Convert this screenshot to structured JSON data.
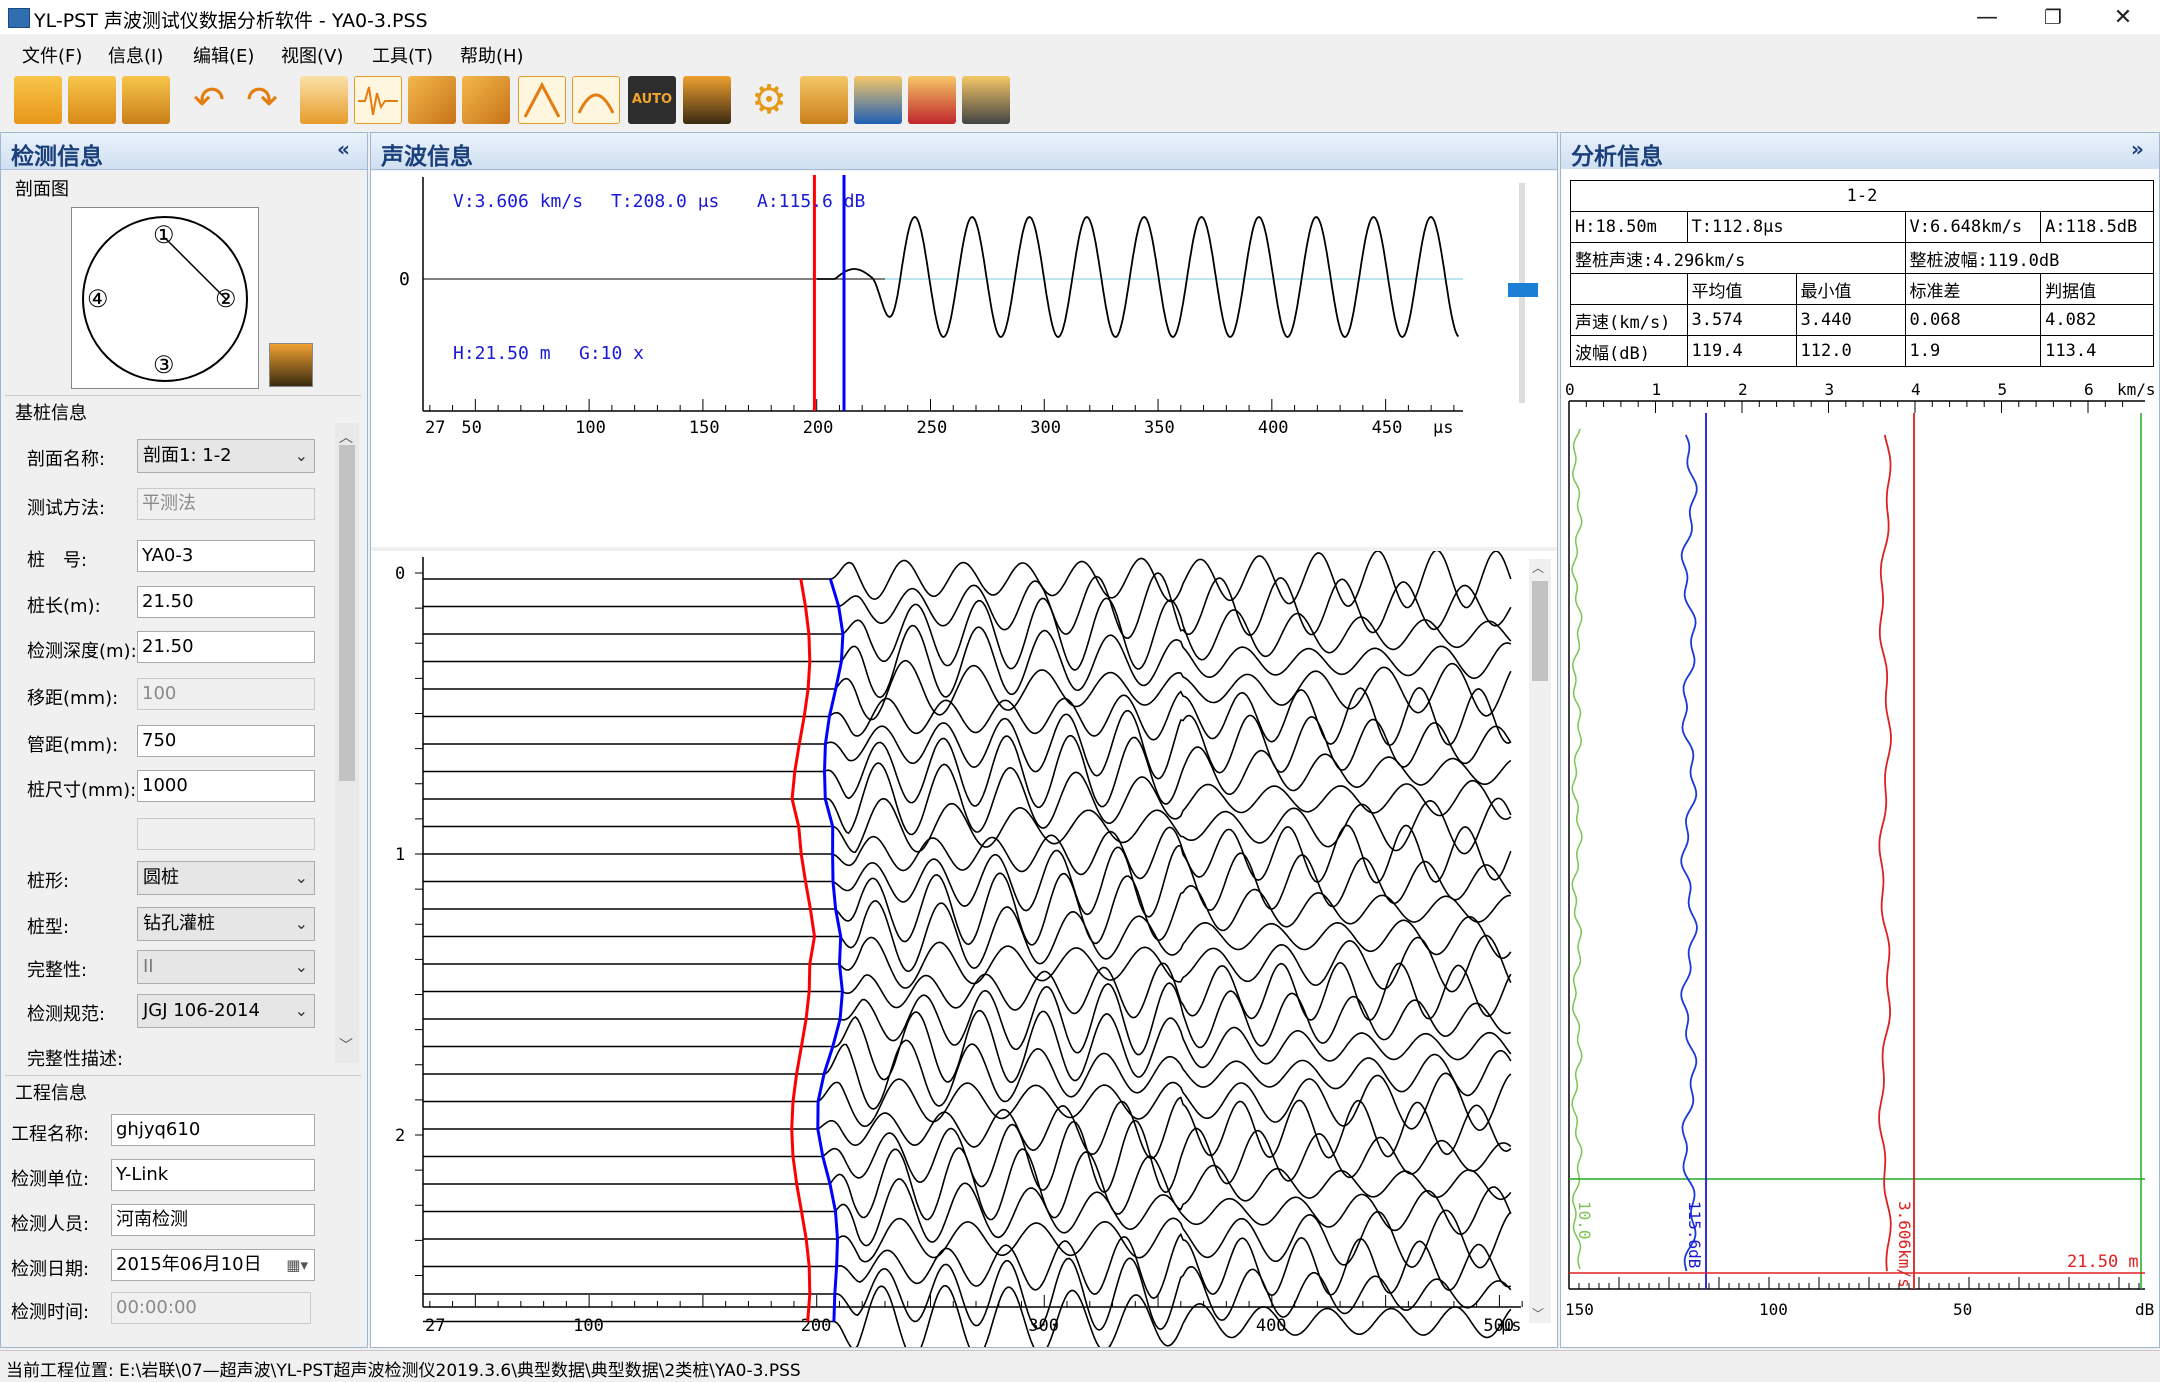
{
  "window": {
    "title": "YL-PST 声波测试仪数据分析软件 - YA0-3.PSS",
    "minimize": "—",
    "restore": "❐",
    "close": "✕"
  },
  "menu": [
    "文件(F)",
    "信息(I)",
    "编辑(E)",
    "视图(V)",
    "工具(T)",
    "帮助(H)"
  ],
  "toolbar": {
    "icons": [
      "open-folder-icon",
      "save-icon",
      "save-as-icon",
      "undo-icon",
      "redo-icon",
      "import-icon",
      "waveform-icon",
      "pile-edit-icon",
      "pile-edit-2-icon",
      "peak-up-icon",
      "peak-down-icon",
      "auto-icon",
      "people-icon",
      "settings-icon",
      "camera-settings-icon",
      "word-export-icon",
      "pdf-export-icon",
      "batch-settings-icon"
    ],
    "auto_label": "AUTO"
  },
  "left_panel": {
    "title": "检测信息",
    "collapse": "«",
    "section_profile": "剖面图",
    "diagram_labels": [
      "①",
      "②",
      "③",
      "④"
    ],
    "section_pile": "基桩信息",
    "fields": {
      "profile_name": {
        "label": "剖面名称:",
        "value": "剖面1: 1-2"
      },
      "test_method": {
        "label": "测试方法:",
        "value": "平测法"
      },
      "pile_no": {
        "label": "桩　号:",
        "value": "YA0-3"
      },
      "pile_length": {
        "label": "桩长(m):",
        "value": "21.50"
      },
      "test_depth": {
        "label": "检测深度(m):",
        "value": "21.50"
      },
      "offset": {
        "label": "移距(mm):",
        "value": "100"
      },
      "pipe_distance": {
        "label": "管距(mm):",
        "value": "750"
      },
      "pile_size": {
        "label": "桩尺寸(mm):",
        "value": "1000"
      },
      "blank": {
        "value": ""
      },
      "pile_shape": {
        "label": "桩形:",
        "value": "圆桩"
      },
      "pile_type": {
        "label": "桩型:",
        "value": "钻孔灌桩"
      },
      "integrity": {
        "label": "完整性:",
        "value": "II"
      },
      "standard": {
        "label": "检测规范:",
        "value": "JGJ 106-2014"
      },
      "integrity_desc": {
        "label": "完整性描述:"
      }
    },
    "section_project": "工程信息",
    "project": {
      "name": {
        "label": "工程名称:",
        "value": "ghjyq610"
      },
      "unit": {
        "label": "检测单位:",
        "value": "Y-Link"
      },
      "person": {
        "label": "检测人员:",
        "value": "河南检测"
      },
      "date": {
        "label": "检测日期:",
        "value": "2015年06月10日"
      },
      "time": {
        "label": "检测时间:",
        "value": "00:00:00"
      }
    }
  },
  "middle_panel": {
    "title": "声波信息",
    "wave_info": {
      "v": "V:3.606 km/s",
      "t": "T:208.0 μs",
      "a": "A:115.6 dB",
      "h": "H:21.50 m",
      "g": "G:10 x",
      "zero": "0"
    },
    "top_axis_ticks": [
      "27",
      "50",
      "100",
      "150",
      "200",
      "250",
      "300",
      "350",
      "400",
      "450",
      "μs"
    ],
    "bottom_axis_ticks": [
      "27",
      "100",
      "200",
      "300",
      "400",
      "500",
      "μs"
    ],
    "depth_labels": [
      "0",
      "1",
      "2"
    ],
    "colors": {
      "first_arrival": "#ff0000",
      "blue_line": "#0000ff",
      "wave": "#000000"
    }
  },
  "right_panel": {
    "title": "分析信息",
    "collapse": "»",
    "table": {
      "header": "1-2",
      "row1": [
        "H:18.50m",
        "T:112.8μs",
        "V:6.648km/s",
        "A:118.5dB"
      ],
      "row2": [
        "整桩声速:4.296km/s",
        "整桩波幅:119.0dB"
      ],
      "cols": [
        "",
        "平均值",
        "最小值",
        "标准差",
        "判据值"
      ],
      "speed": [
        "声速(km/s)",
        "3.574",
        "3.440",
        "0.068",
        "4.082"
      ],
      "amplitude": [
        "波幅(dB)",
        "119.4",
        "112.0",
        "1.9",
        "113.4"
      ]
    },
    "top_axis": [
      "0",
      "1",
      "2",
      "3",
      "4",
      "5",
      "6",
      "km/s"
    ],
    "bottom_axis": [
      "150",
      "100",
      "50",
      "dB"
    ],
    "labels": {
      "green": "10.0",
      "blue": "115.6dB",
      "red": "3.606km/s",
      "depth": "21.50 m"
    }
  },
  "status": {
    "text": "当前工程位置:  E:\\岩联\\07—超声波\\YL-PST超声波检测仪2019.3.6\\典型数据\\典型数据\\2类桩\\YA0-3.PSS"
  }
}
